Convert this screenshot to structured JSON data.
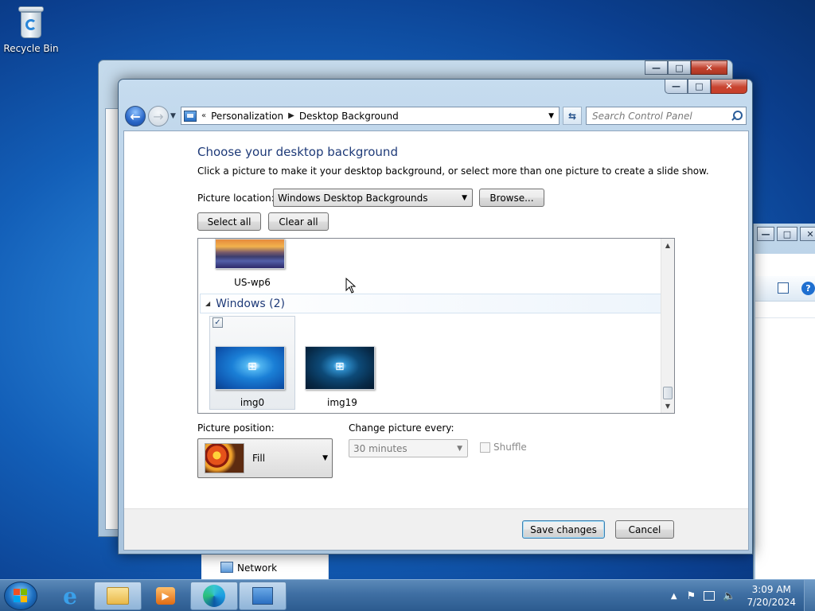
{
  "desktop": {
    "recycle_bin_label": "Recycle Bin"
  },
  "background_window": {
    "network_label": "Network"
  },
  "window": {
    "address": {
      "crumbs": [
        "Personalization",
        "Desktop Background"
      ],
      "back_symbol": "«"
    },
    "search_placeholder": "Search Control Panel",
    "title": "Choose your desktop background",
    "description": "Click a picture to make it your desktop background, or select more than one picture to create a slide show.",
    "picture_location_label": "Picture location:",
    "picture_location_value": "Windows Desktop Backgrounds",
    "browse_label": "Browse...",
    "select_all_label": "Select all",
    "clear_all_label": "Clear all",
    "images": [
      {
        "name": "US-wp6",
        "selected": false
      },
      {
        "name": "img0",
        "selected": true
      },
      {
        "name": "img19",
        "selected": false
      }
    ],
    "group": {
      "name": "Windows (2)"
    },
    "picture_position_label": "Picture position:",
    "picture_position_value": "Fill",
    "change_every_label": "Change picture every:",
    "change_every_value": "30 minutes",
    "shuffle_label": "Shuffle",
    "save_label": "Save changes",
    "cancel_label": "Cancel"
  },
  "taskbar": {
    "time": "3:09 AM",
    "date": "7/20/2024",
    "apps": [
      "start",
      "internet-explorer",
      "file-explorer",
      "media-player",
      "edge",
      "control-panel"
    ]
  },
  "colors": {
    "title_blue": "#1e3a78",
    "taskbar": "#3f6fa3",
    "close_red": "#c8432f"
  }
}
